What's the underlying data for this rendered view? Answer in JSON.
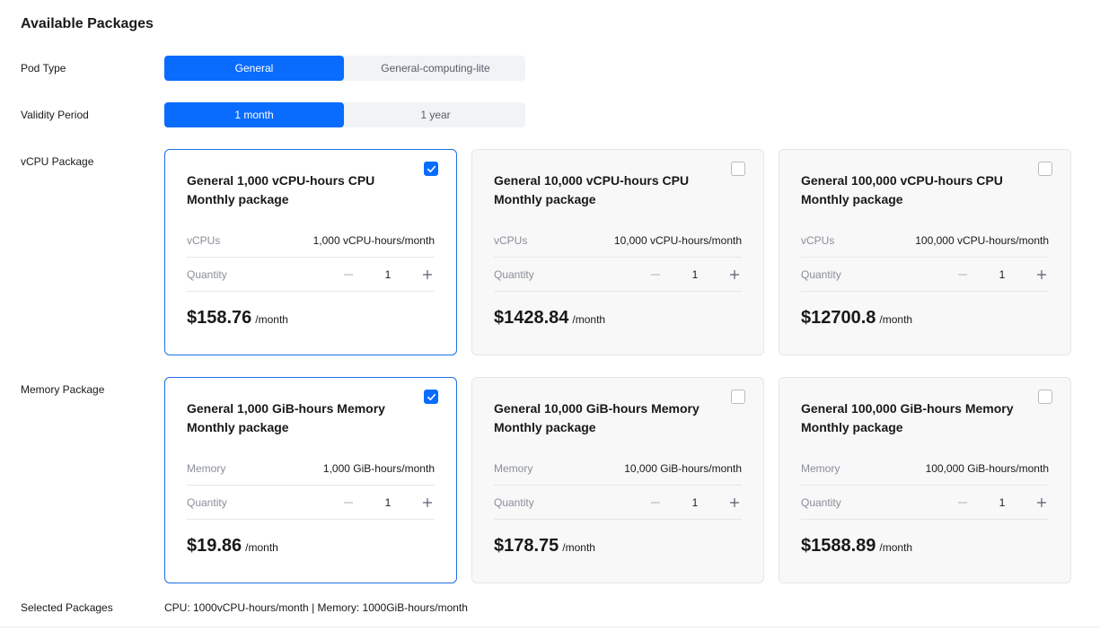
{
  "title": "Available Packages",
  "pod_type": {
    "label": "Pod Type",
    "options": [
      "General",
      "General-computing-lite"
    ],
    "selected": "General"
  },
  "validity": {
    "label": "Validity Period",
    "options": [
      "1 month",
      "1 year"
    ],
    "selected": "1 month"
  },
  "vcpu": {
    "label": "vCPU Package",
    "cards": [
      {
        "title": "General 1,000 vCPU-hours CPU Monthly package",
        "spec_label": "vCPUs",
        "spec_value": "1,000 vCPU-hours/month",
        "qty_label": "Quantity",
        "qty": "1",
        "price": "$158.76",
        "unit": "/month",
        "checked": true
      },
      {
        "title": "General 10,000 vCPU-hours CPU Monthly package",
        "spec_label": "vCPUs",
        "spec_value": "10,000 vCPU-hours/month",
        "qty_label": "Quantity",
        "qty": "1",
        "price": "$1428.84",
        "unit": "/month",
        "checked": false
      },
      {
        "title": "General 100,000 vCPU-hours CPU Monthly package",
        "spec_label": "vCPUs",
        "spec_value": "100,000 vCPU-hours/month",
        "qty_label": "Quantity",
        "qty": "1",
        "price": "$12700.8",
        "unit": "/month",
        "checked": false
      }
    ]
  },
  "memory": {
    "label": "Memory Package",
    "cards": [
      {
        "title": "General 1,000 GiB-hours Memory Monthly package",
        "spec_label": "Memory",
        "spec_value": "1,000 GiB-hours/month",
        "qty_label": "Quantity",
        "qty": "1",
        "price": "$19.86",
        "unit": "/month",
        "checked": true
      },
      {
        "title": "General 10,000 GiB-hours Memory Monthly package",
        "spec_label": "Memory",
        "spec_value": "10,000 GiB-hours/month",
        "qty_label": "Quantity",
        "qty": "1",
        "price": "$178.75",
        "unit": "/month",
        "checked": false
      },
      {
        "title": "General 100,000 GiB-hours Memory Monthly package",
        "spec_label": "Memory",
        "spec_value": "100,000 GiB-hours/month",
        "qty_label": "Quantity",
        "qty": "1",
        "price": "$1588.89",
        "unit": "/month",
        "checked": false
      }
    ]
  },
  "selected_packages": {
    "label": "Selected Packages",
    "value": "CPU: 1000vCPU-hours/month | Memory: 1000GiB-hours/month"
  },
  "colors": {
    "accent": "#0a6cff",
    "selected_border": "#1f6fe6",
    "card_bg": "#f8f8f8"
  },
  "icons": {
    "checkbox": "check-icon",
    "decrement": "minus-icon",
    "increment": "plus-icon"
  }
}
